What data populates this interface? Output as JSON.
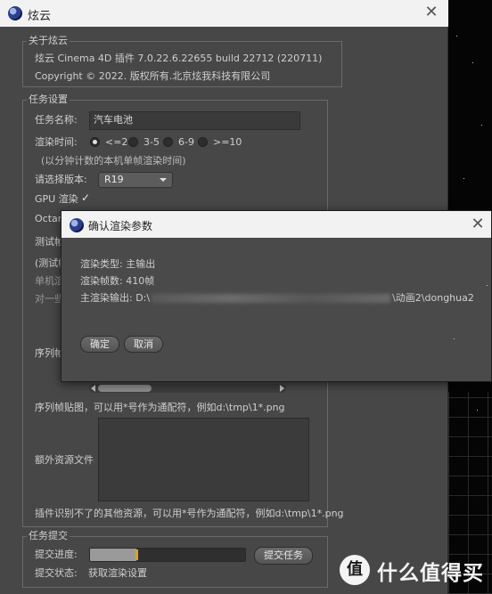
{
  "window": {
    "title": "炫云"
  },
  "about": {
    "group_title": "关于炫云",
    "version_line": "炫云 Cinema 4D 插件 7.0.22.6.22655 build 22712  (220711)",
    "copyright_line": "Copyright © 2022. 版权所有.北京炫我科技有限公司"
  },
  "task_settings": {
    "group_title": "任务设置",
    "task_name_label": "任务名称:",
    "task_name_value": "汽车电池",
    "render_time_label": "渲染时间:",
    "render_time_options": [
      "<=2",
      "3-5",
      "6-9",
      ">=10"
    ],
    "render_time_selected": "<=2",
    "render_time_hint": "(以分钟计数的本机单帧渲染时间)",
    "version_label": "请选择版本:",
    "version_value": "R19",
    "gpu_label": "GPU 渲染",
    "gpu_checked": true,
    "octane_label_partial": "Octar",
    "test_label_partial": "测试帧",
    "test_hint_partial": "(测试帧",
    "single_machine_partial": "单机渲",
    "pair_partial": "对一些",
    "sequence_label_partial": "序列帧",
    "sequence_hint": "序列帧贴图，可以用*号作为通配符，例如d:\\tmp\\1*.png",
    "extra_label": "额外资源文件",
    "extra_hint": "插件识别不了的其他资源，可以用*号作为通配符，例如d:\\tmp\\1*.png"
  },
  "submit": {
    "group_title": "任务提交",
    "progress_label": "提交进度:",
    "progress_fraction": 0.3,
    "submit_button": "提交任务",
    "status_label": "提交状态:",
    "status_value": "获取渲染设置"
  },
  "dialog": {
    "title": "确认渲染参数",
    "render_type_label": "渲染类型: 主输出",
    "frame_count_label": "渲染帧数: 410帧",
    "output_prefix": "主渲染输出:  D:\\",
    "output_suffix": "\\动画2\\donghua2",
    "ok_button": "确定",
    "cancel_button": "取消"
  },
  "watermark": {
    "logo_glyph": "值",
    "text": "什么值得买"
  },
  "colors": {
    "window_bg": "#474747",
    "progress_accent": "#e0a020"
  }
}
